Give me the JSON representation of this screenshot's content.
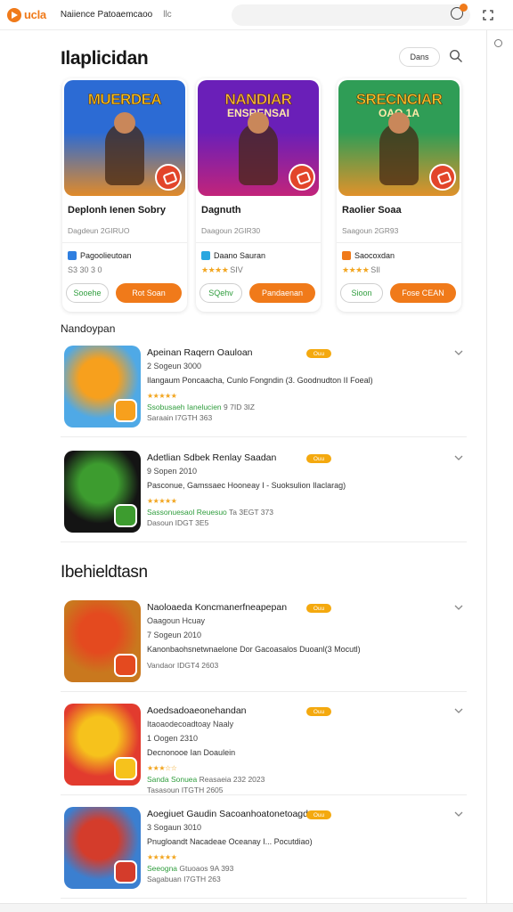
{
  "app": {
    "logo": "ucla",
    "nav_primary": "Naiience Patoaemcaoo",
    "nav_secondary": "llc"
  },
  "header": {
    "title": "Ilaplicidan",
    "sort_label": "Dans"
  },
  "featured": [
    {
      "art_title": "MUERDEA",
      "art_subtitle": "",
      "name": "Deplonh Ienen Sobry",
      "meta": "Dagdeun 2GIRUO",
      "developer": "Pagoolieutoan",
      "rating_text": "S3 30 3 0",
      "rating": 0,
      "price": "Sooehe",
      "action": "Rot Soan",
      "colors": {
        "sky": "#2c6bd4",
        "ground": "#e08a2a",
        "title": "#f6c21c",
        "dev_icon": "#2f7fe0"
      }
    },
    {
      "art_title": "NANDIAR",
      "art_subtitle": "ENSRENSAI",
      "name": "Dagnuth",
      "meta": "Daagoun 2GIR30",
      "developer": "Daano Sauran",
      "rating_text": "SIV",
      "rating": 4,
      "price": "SQehv",
      "action": "Pandaenan",
      "colors": {
        "sky": "#6a1fb8",
        "ground": "#c2247a",
        "title": "#f7b63c",
        "dev_icon": "#2aa7e0"
      }
    },
    {
      "art_title": "SRECNCIAR",
      "art_subtitle": "OAO 1A",
      "name": "Raolier Soaa",
      "meta": "Saagoun 2GR93",
      "developer": "Saocoxdan",
      "rating_text": "SIl",
      "rating": 4,
      "price": "Sioon",
      "action": "Fose CEAN",
      "colors": {
        "sky": "#2f9d56",
        "ground": "#e0922b",
        "title": "#f5c22a",
        "dev_icon": "#f07a1a"
      }
    }
  ],
  "section_recent": "Nandoypan",
  "recent": [
    {
      "title": "Apeinan Raqern Oauloan",
      "tag": "Ouu",
      "sub": "2 Sogeun 3000",
      "desc": "Ilangaum Poncaacha, Cunlo Fongndin (3. Goodnudton II Foeal)",
      "rating": 5,
      "downloads": "Ssobusaeh Ianelucien",
      "size": "9 7ID 3IZ",
      "updated": "Saraain I7GTH 363",
      "colors": {
        "bg": "#4fa9e6",
        "accent": "#f7a01d"
      }
    },
    {
      "title": "Adetlian Sdbek Renlay Saadan",
      "tag": "Ouu",
      "sub": "9 Sopen 2010",
      "desc": "Pasconue, Gamssaec Hooneay I - Suoksulion Ilaclarag)",
      "rating": 5,
      "downloads": "Sassonuesaol Reuesuo",
      "size": "Ta 3EGT 373",
      "updated": "Dasoun IDGT 3E5",
      "colors": {
        "bg": "#141414",
        "accent": "#3d9c2f"
      }
    }
  ],
  "section_more": "Ibehieldtasn",
  "more": [
    {
      "title": "Naoloaeda Koncmanerfneapepan",
      "sub": "Oaagoun Hcuay",
      "tag": "Ouu",
      "line3": "7 Sogeun 2010",
      "desc": "Kanonbaohsnetwnaelone Dor Gacoasalos Duoanl(3 Mocutl)",
      "updated": "Vandaor IDGT4 2603",
      "rating": 0,
      "downloads": "",
      "size": "",
      "colors": {
        "bg": "#c9781e",
        "accent": "#e44a1f"
      }
    },
    {
      "title": "Aoedsadoaeonehandan",
      "sub": "Itaoaodecoadtoay Naaly",
      "tag": "Ouu",
      "line3": "1 Oogen 2310",
      "desc": "Decnonooe Ian Doaulein",
      "rating": 3,
      "downloads": "Sanda Sonuea",
      "size": "Reasaeia 232 2023",
      "updated": "Tasasoun ITGTH 2605",
      "colors": {
        "bg": "#e23b2e",
        "accent": "#f6c21c"
      }
    },
    {
      "title": "Aoegiuet Gaudin Sacoanhoatonetoagdaa",
      "tag": "Ouu",
      "sub": "3 Sogaun 3010",
      "desc": "Pnugloandt Nacadeae Oceanay I... Pocutdiao)",
      "rating": 5,
      "downloads": "Seeogna",
      "size": "Gtuoaos 9A 393",
      "updated": "Sagabuan I7GTH 263",
      "colors": {
        "bg": "#3b7fd0",
        "accent": "#d43c2b"
      }
    }
  ]
}
